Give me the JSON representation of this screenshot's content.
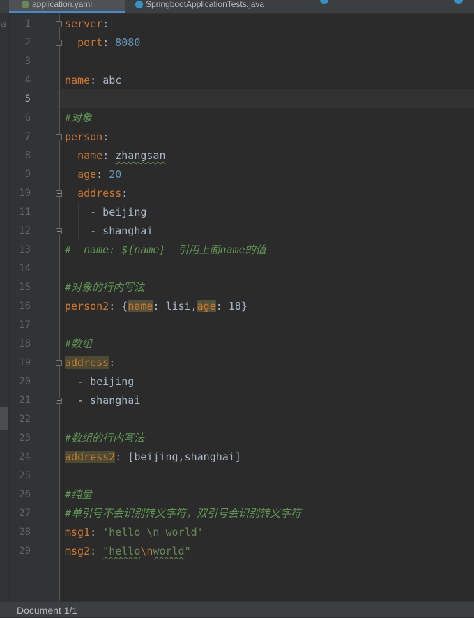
{
  "tabs": [
    {
      "label": "application.yaml",
      "active": true
    },
    {
      "label": "SpringbootApplicationTests.java",
      "active": false
    }
  ],
  "left_strip_text": "\\s",
  "current_line": 5,
  "lines": [
    "1",
    "2",
    "3",
    "4",
    "5",
    "6",
    "7",
    "8",
    "9",
    "10",
    "11",
    "12",
    "13",
    "14",
    "15",
    "16",
    "17",
    "18",
    "19",
    "20",
    "21",
    "22",
    "23",
    "24",
    "25",
    "26",
    "27",
    "28",
    "29"
  ],
  "code": {
    "l1": {
      "key": "server",
      "colon": ":"
    },
    "l2": {
      "key": "port",
      "colon": ": ",
      "value": "8080"
    },
    "l4": {
      "key": "name",
      "colon": ": ",
      "value": "abc"
    },
    "l6": {
      "comment": "#对象"
    },
    "l7": {
      "key": "person",
      "colon": ":"
    },
    "l8": {
      "key": "name",
      "colon": ": ",
      "value": "zhangsan"
    },
    "l9": {
      "key": "age",
      "colon": ": ",
      "value": "20"
    },
    "l10": {
      "key": "address",
      "colon": ":"
    },
    "l11": {
      "item": "- beijing"
    },
    "l12": {
      "item": "- shanghai"
    },
    "l13": {
      "comment": "#  name: ${name}  引用上面name的值"
    },
    "l15": {
      "comment": "#对象的行内写法"
    },
    "l16": {
      "key": "person2",
      "colon": ": {",
      "k1": "name",
      "v1": ": lisi,",
      "k2": "age",
      "v2": ": 18}"
    },
    "l18": {
      "comment": "#数组"
    },
    "l19": {
      "key": "address",
      "colon": ":"
    },
    "l20": {
      "item": "- beijing"
    },
    "l21": {
      "item": "- shanghai"
    },
    "l23": {
      "comment": "#数组的行内写法"
    },
    "l24": {
      "key": "address2",
      "colon": ": ",
      "value": "[beijing,shanghai]"
    },
    "l26": {
      "comment": "#纯量"
    },
    "l27": {
      "comment": "#单引号不会识别转义字符，双引号会识别转义字符"
    },
    "l28": {
      "key": "msg1",
      "colon": ": ",
      "value": "'hello \\n world'"
    },
    "l29": {
      "key": "msg2",
      "colon": ": ",
      "q1": "\"hello",
      "esc": "\\n",
      "word": "world",
      "q2": "\""
    }
  },
  "status": {
    "text": "Document 1/1"
  },
  "colors": {
    "key": "#cc7832",
    "number": "#6897bb",
    "string": "#6a8759",
    "comment": "#629755",
    "text": "#a9b7c6",
    "background": "#2b2b2b"
  }
}
